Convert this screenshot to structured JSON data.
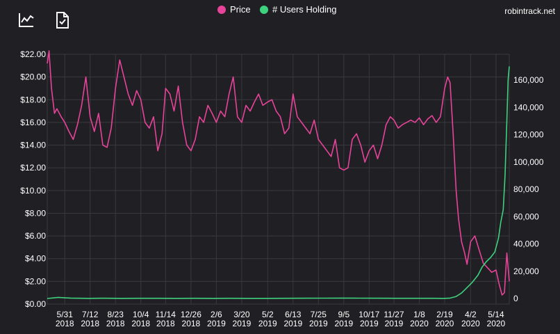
{
  "toolbar": {
    "icons": [
      "chart-line-icon",
      "document-check-icon"
    ]
  },
  "brand": "robintrack.net",
  "colors": {
    "background": "#202024",
    "grid": "#38383e",
    "price": "#e8439a",
    "users": "#3ed17e",
    "text": "#ffffff"
  },
  "chart_data": {
    "type": "line",
    "legend_position": "top-center",
    "grid": true,
    "x_categories": [
      "5/31 2018",
      "7/12 2018",
      "8/23 2018",
      "10/4 2018",
      "11/14 2018",
      "12/26 2018",
      "2/6 2019",
      "3/20 2019",
      "5/2 2019",
      "6/13 2019",
      "7/25 2019",
      "9/5 2019",
      "10/17 2019",
      "11/27 2019",
      "1/8 2020",
      "2/19 2020",
      "4/2 2020",
      "5/14 2020"
    ],
    "x_tick_labels": [
      [
        "5/31",
        "2018"
      ],
      [
        "7/12",
        "2018"
      ],
      [
        "8/23",
        "2018"
      ],
      [
        "10/4",
        "2018"
      ],
      [
        "11/14",
        "2018"
      ],
      [
        "12/26",
        "2018"
      ],
      [
        "2/6",
        "2019"
      ],
      [
        "3/20",
        "2019"
      ],
      [
        "5/2",
        "2019"
      ],
      [
        "6/13",
        "2019"
      ],
      [
        "7/25",
        "2019"
      ],
      [
        "9/5",
        "2019"
      ],
      [
        "10/17",
        "2019"
      ],
      [
        "11/27",
        "2019"
      ],
      [
        "1/8",
        "2020"
      ],
      [
        "2/19",
        "2020"
      ],
      [
        "4/2",
        "2020"
      ],
      [
        "5/14",
        "2020"
      ]
    ],
    "x_range": [
      "5/2 2018",
      "6/5 2020"
    ],
    "y_left": {
      "ticks": [
        "$0.00",
        "$2.00",
        "$4.00",
        "$6.00",
        "$8.00",
        "$10.00",
        "$12.00",
        "$14.00",
        "$16.00",
        "$18.00",
        "$20.00",
        "$22.00"
      ],
      "range": [
        0,
        22
      ]
    },
    "y_right": {
      "ticks": [
        "0",
        "20,000",
        "40,000",
        "60,000",
        "80,000",
        "100,000",
        "120,000",
        "140,000",
        "160,000"
      ],
      "range": [
        0,
        160000
      ]
    },
    "series": [
      {
        "name": "Price",
        "axis": "left",
        "x": [
          "5/2 2018",
          "5/5 2018",
          "5/9 2018",
          "5/14 2018",
          "5/18 2018",
          "5/25 2018",
          "5/31 2018",
          "6/7 2018",
          "6/14 2018",
          "6/21 2018",
          "6/28 2018",
          "7/5 2018",
          "7/12 2018",
          "7/19 2018",
          "7/26 2018",
          "8/2 2018",
          "8/9 2018",
          "8/16 2018",
          "8/23 2018",
          "8/30 2018",
          "9/6 2018",
          "9/13 2018",
          "9/20 2018",
          "9/27 2018",
          "10/4 2018",
          "10/11 2018",
          "10/18 2018",
          "10/25 2018",
          "11/1 2018",
          "11/8 2018",
          "11/14 2018",
          "11/21 2018",
          "11/28 2018",
          "12/5 2018",
          "12/12 2018",
          "12/19 2018",
          "12/26 2018",
          "1/2 2019",
          "1/9 2019",
          "1/16 2019",
          "1/23 2019",
          "1/30 2019",
          "2/6 2019",
          "2/13 2019",
          "2/20 2019",
          "2/27 2019",
          "3/6 2019",
          "3/13 2019",
          "3/20 2019",
          "3/27 2019",
          "4/3 2019",
          "4/10 2019",
          "4/17 2019",
          "4/24 2019",
          "5/2 2019",
          "5/9 2019",
          "5/16 2019",
          "5/23 2019",
          "5/30 2019",
          "6/6 2019",
          "6/13 2019",
          "6/20 2019",
          "6/27 2019",
          "7/4 2019",
          "7/11 2019",
          "7/18 2019",
          "7/25 2019",
          "8/1 2019",
          "8/8 2019",
          "8/15 2019",
          "8/22 2019",
          "8/29 2019",
          "9/5 2019",
          "9/12 2019",
          "9/19 2019",
          "9/26 2019",
          "10/3 2019",
          "10/10 2019",
          "10/17 2019",
          "10/24 2019",
          "10/31 2019",
          "11/7 2019",
          "11/14 2019",
          "11/21 2019",
          "11/27 2019",
          "12/4 2019",
          "12/11 2019",
          "12/18 2019",
          "12/25 2019",
          "1/1 2020",
          "1/8 2020",
          "1/15 2020",
          "1/22 2020",
          "1/29 2020",
          "2/5 2020",
          "2/12 2020",
          "2/19 2020",
          "2/24 2020",
          "2/28 2020",
          "3/4 2020",
          "3/9 2020",
          "3/13 2020",
          "3/18 2020",
          "3/23 2020",
          "3/27 2020",
          "4/2 2020",
          "4/9 2020",
          "4/16 2020",
          "4/23 2020",
          "4/30 2020",
          "5/7 2020",
          "5/14 2020",
          "5/19 2020",
          "5/24 2020",
          "5/28 2020",
          "6/1 2020",
          "6/5 2020"
        ],
        "values": [
          21.2,
          22.3,
          19.0,
          16.8,
          17.2,
          16.5,
          16.0,
          15.2,
          14.5,
          15.8,
          17.5,
          20.0,
          16.5,
          15.2,
          16.8,
          14.0,
          13.8,
          15.5,
          19.0,
          21.5,
          20.0,
          18.5,
          17.5,
          18.8,
          18.0,
          16.0,
          15.5,
          16.5,
          13.5,
          15.0,
          19.0,
          18.5,
          17.0,
          19.2,
          16.0,
          14.0,
          13.5,
          14.5,
          16.5,
          16.0,
          17.5,
          16.8,
          16.0,
          17.0,
          16.5,
          18.5,
          20.0,
          16.5,
          16.0,
          17.5,
          17.0,
          17.8,
          18.5,
          17.5,
          17.8,
          18.0,
          17.0,
          16.5,
          15.0,
          15.5,
          18.5,
          16.5,
          16.0,
          15.5,
          15.0,
          16.2,
          14.5,
          14.0,
          13.5,
          13.0,
          14.5,
          12.0,
          11.8,
          12.0,
          14.5,
          15.0,
          14.0,
          12.5,
          13.5,
          14.0,
          12.8,
          14.0,
          15.8,
          16.5,
          16.2,
          15.5,
          15.8,
          16.0,
          16.2,
          16.0,
          16.4,
          15.8,
          16.3,
          16.6,
          16.0,
          16.5,
          19.0,
          20.0,
          19.5,
          15.0,
          10.0,
          7.5,
          5.5,
          4.5,
          3.5,
          5.5,
          6.0,
          4.8,
          3.6,
          3.2,
          2.8,
          3.0,
          1.8,
          0.8,
          1.0,
          4.5,
          2.0
        ]
      },
      {
        "name": "# Users Holding",
        "axis": "right",
        "x": [
          "5/2 2018",
          "5/20 2018",
          "6/10 2018",
          "7/10 2018",
          "8/1 2018",
          "9/1 2018",
          "10/1 2018",
          "11/1 2018",
          "12/1 2018",
          "1/1 2019",
          "2/1 2019",
          "3/1 2019",
          "4/1 2019",
          "5/1 2019",
          "6/1 2019",
          "7/1 2019",
          "8/1 2019",
          "9/1 2019",
          "10/1 2019",
          "11/1 2019",
          "12/1 2019",
          "1/1 2020",
          "2/1 2020",
          "2/19 2020",
          "2/28 2020",
          "3/9 2020",
          "3/18 2020",
          "3/27 2020",
          "4/5 2020",
          "4/14 2020",
          "4/21 2020",
          "4/28 2020",
          "5/5 2020",
          "5/12 2020",
          "5/18 2020",
          "5/22 2020",
          "5/26 2020",
          "5/29 2020",
          "6/1 2020",
          "6/3 2020",
          "6/5 2020"
        ],
        "values": [
          0,
          800,
          300,
          100,
          200,
          100,
          150,
          150,
          100,
          150,
          100,
          150,
          100,
          100,
          150,
          200,
          250,
          300,
          250,
          200,
          150,
          150,
          150,
          100,
          300,
          1500,
          4000,
          8000,
          12000,
          17000,
          23000,
          27000,
          30000,
          34000,
          44000,
          56000,
          65000,
          90000,
          130000,
          160000,
          170000
        ]
      }
    ]
  }
}
